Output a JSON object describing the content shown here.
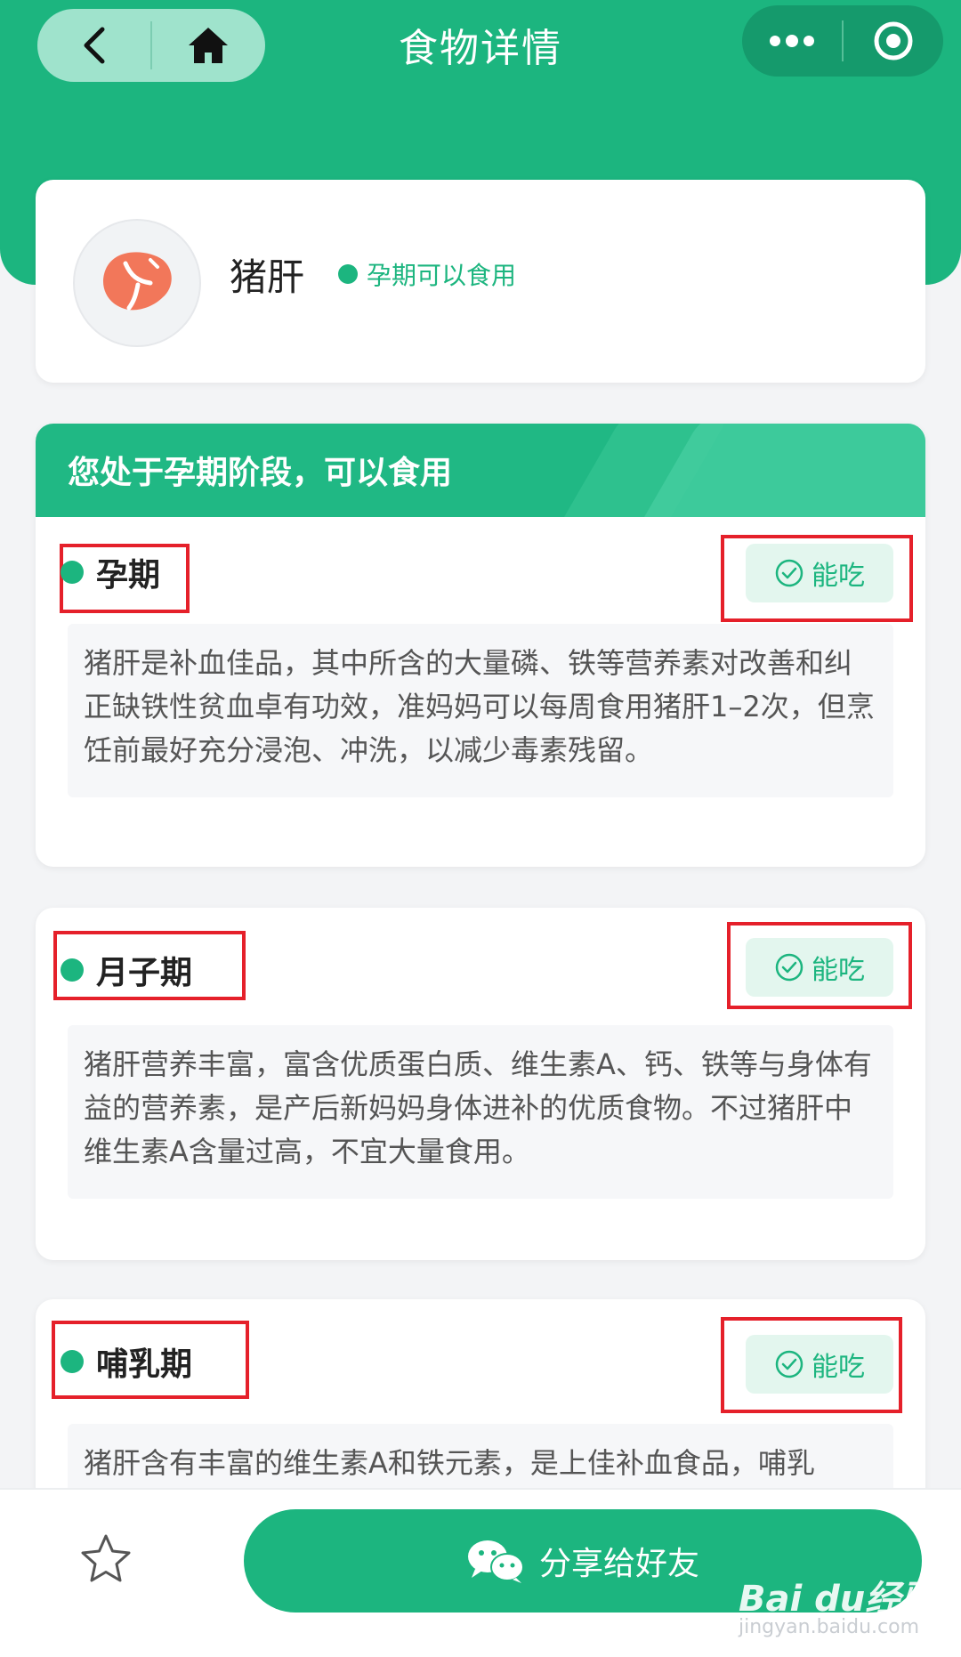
{
  "nav": {
    "title": "食物详情",
    "back_icon": "chevron-left-icon",
    "home_icon": "home-icon",
    "more_icon": "more-dots-icon",
    "close_icon": "target-circle-icon"
  },
  "food": {
    "name": "猪肝",
    "status": "孕期可以食用",
    "icon": "pork-liver-icon"
  },
  "banner": {
    "text": "您处于孕期阶段，可以食用"
  },
  "stages": [
    {
      "title": "孕期",
      "badge": "能吃",
      "desc": "猪肝是补血佳品，其中所含的大量磷、铁等营养素对改善和纠正缺铁性贫血卓有功效，准妈妈可以每周食用猪肝1–2次，但烹饪前最好充分浸泡、冲洗，以减少毒素残留。"
    },
    {
      "title": "月子期",
      "badge": "能吃",
      "desc": "猪肝营养丰富，富含优质蛋白质、维生素A、钙、铁等与身体有益的营养素，是产后新妈妈身体进补的优质食物。不过猪肝中维生素A含量过高，不宜大量食用。"
    },
    {
      "title": "哺乳期",
      "badge": "能吃",
      "desc": "猪肝含有丰富的维生素A和铁元素，是上佳补血食品，哺乳"
    }
  ],
  "bottom": {
    "share_label": "分享给好友",
    "star_icon": "star-outline-icon",
    "wechat_icon": "wechat-icon"
  },
  "watermark": {
    "text": "Bai du经验",
    "sub": "jingyan.baidu.com"
  },
  "colors": {
    "primary": "#1cb57f",
    "highlight_border": "#e5202a"
  }
}
